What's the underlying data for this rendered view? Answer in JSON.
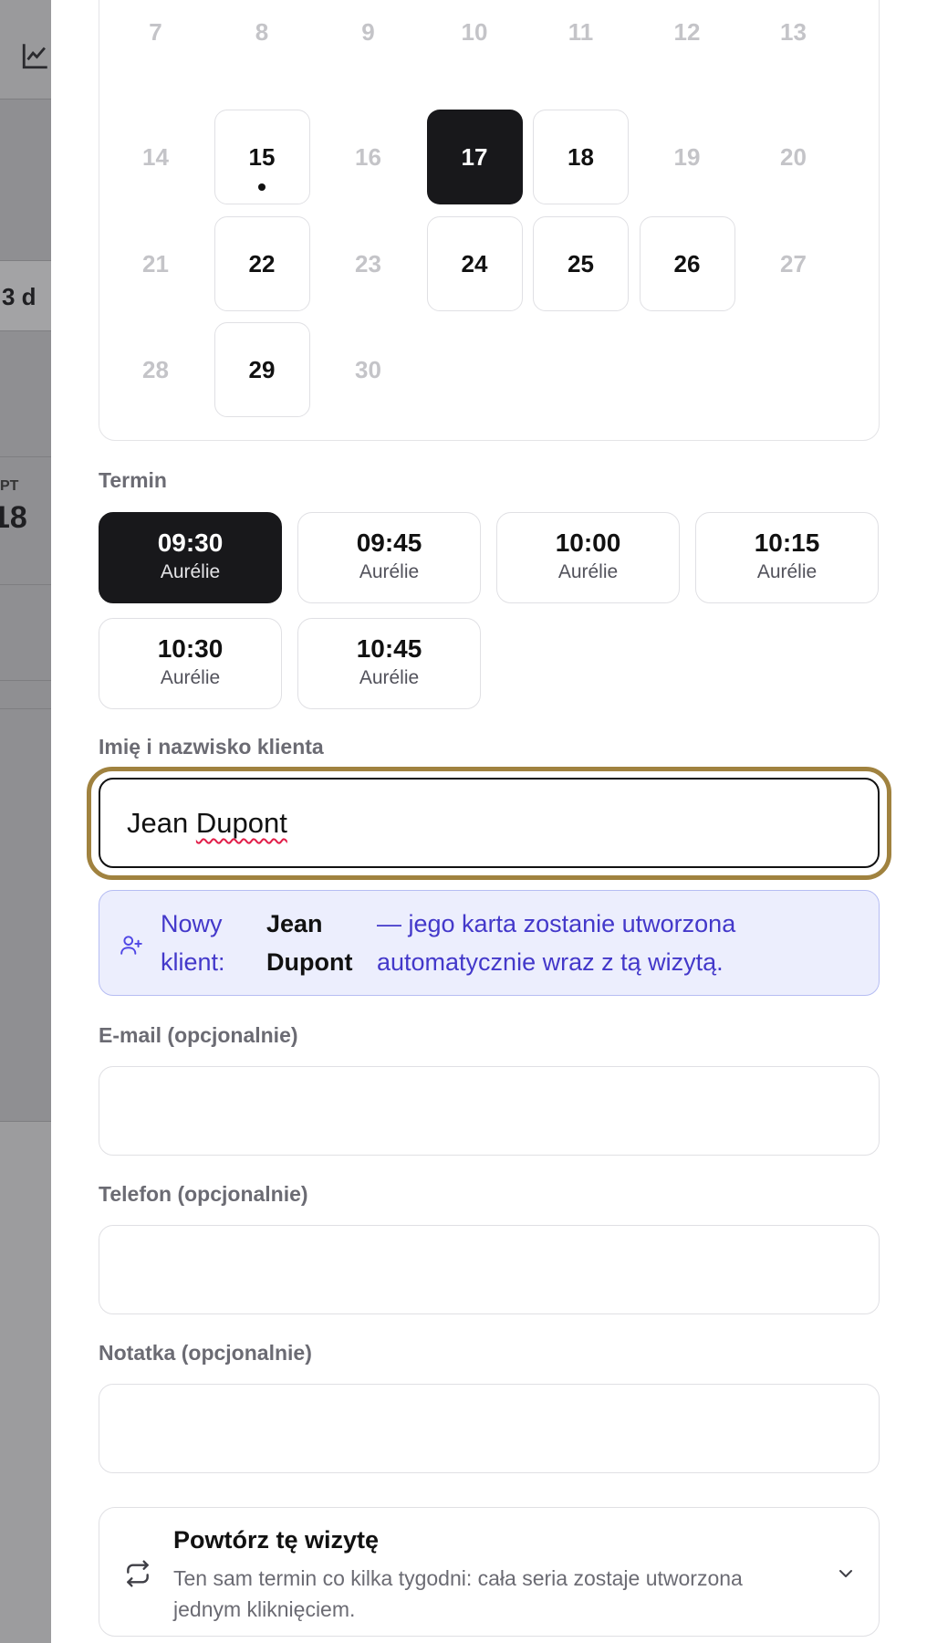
{
  "background": {
    "badge_label": "3 d",
    "day_abbr": "PT",
    "day_number": "18"
  },
  "calendar": {
    "rows": [
      [
        {
          "day": "7",
          "state": "muted"
        },
        {
          "day": "8",
          "state": "muted"
        },
        {
          "day": "9",
          "state": "muted"
        },
        {
          "day": "10",
          "state": "muted"
        },
        {
          "day": "11",
          "state": "muted"
        },
        {
          "day": "12",
          "state": "muted"
        },
        {
          "day": "13",
          "state": "muted"
        }
      ],
      [
        {
          "day": "14",
          "state": "muted"
        },
        {
          "day": "15",
          "state": "available",
          "dot": true
        },
        {
          "day": "16",
          "state": "muted"
        },
        {
          "day": "17",
          "state": "selected"
        },
        {
          "day": "18",
          "state": "available"
        },
        {
          "day": "19",
          "state": "muted"
        },
        {
          "day": "20",
          "state": "muted"
        }
      ],
      [
        {
          "day": "21",
          "state": "muted"
        },
        {
          "day": "22",
          "state": "available"
        },
        {
          "day": "23",
          "state": "muted"
        },
        {
          "day": "24",
          "state": "available"
        },
        {
          "day": "25",
          "state": "available"
        },
        {
          "day": "26",
          "state": "available"
        },
        {
          "day": "27",
          "state": "muted"
        }
      ],
      [
        {
          "day": "28",
          "state": "muted"
        },
        {
          "day": "29",
          "state": "available"
        },
        {
          "day": "30",
          "state": "muted"
        }
      ]
    ]
  },
  "time": {
    "label": "Termin",
    "slots": [
      {
        "time": "09:30",
        "person": "Aurélie",
        "selected": true
      },
      {
        "time": "09:45",
        "person": "Aurélie",
        "selected": false
      },
      {
        "time": "10:00",
        "person": "Aurélie",
        "selected": false
      },
      {
        "time": "10:15",
        "person": "Aurélie",
        "selected": false
      },
      {
        "time": "10:30",
        "person": "Aurélie",
        "selected": false
      },
      {
        "time": "10:45",
        "person": "Aurélie",
        "selected": false
      }
    ]
  },
  "client": {
    "label": "Imię i nazwisko klienta",
    "value_first": "Jean",
    "value_last": "Dupont"
  },
  "new_client_notice": {
    "prefix_line1": "Nowy",
    "prefix_line2": "klient:",
    "name_line1": "Jean",
    "name_line2": "Dupont",
    "message_line1": "— jego karta zostanie utworzona",
    "message_line2": "automatycznie wraz z tą wizytą."
  },
  "email": {
    "label": "E-mail (opcjonalnie)",
    "value": ""
  },
  "phone": {
    "label": "Telefon (opcjonalnie)",
    "value": ""
  },
  "note": {
    "label": "Notatka (opcjonalnie)",
    "value": ""
  },
  "repeat": {
    "title": "Powtórz tę wizytę",
    "description": "Ten sam termin co kilka tygodni: cała seria zostaje utworzona jednym kliknięciem."
  },
  "colors": {
    "selected": "#18181b",
    "focus_ring": "#a0823f",
    "notice_bg": "#eceefd",
    "notice_text": "#4338ca"
  },
  "icons": {
    "chart": "line-chart-icon",
    "new_client": "user-plus-icon",
    "repeat": "repeat-icon",
    "expand": "chevron-down-icon"
  }
}
